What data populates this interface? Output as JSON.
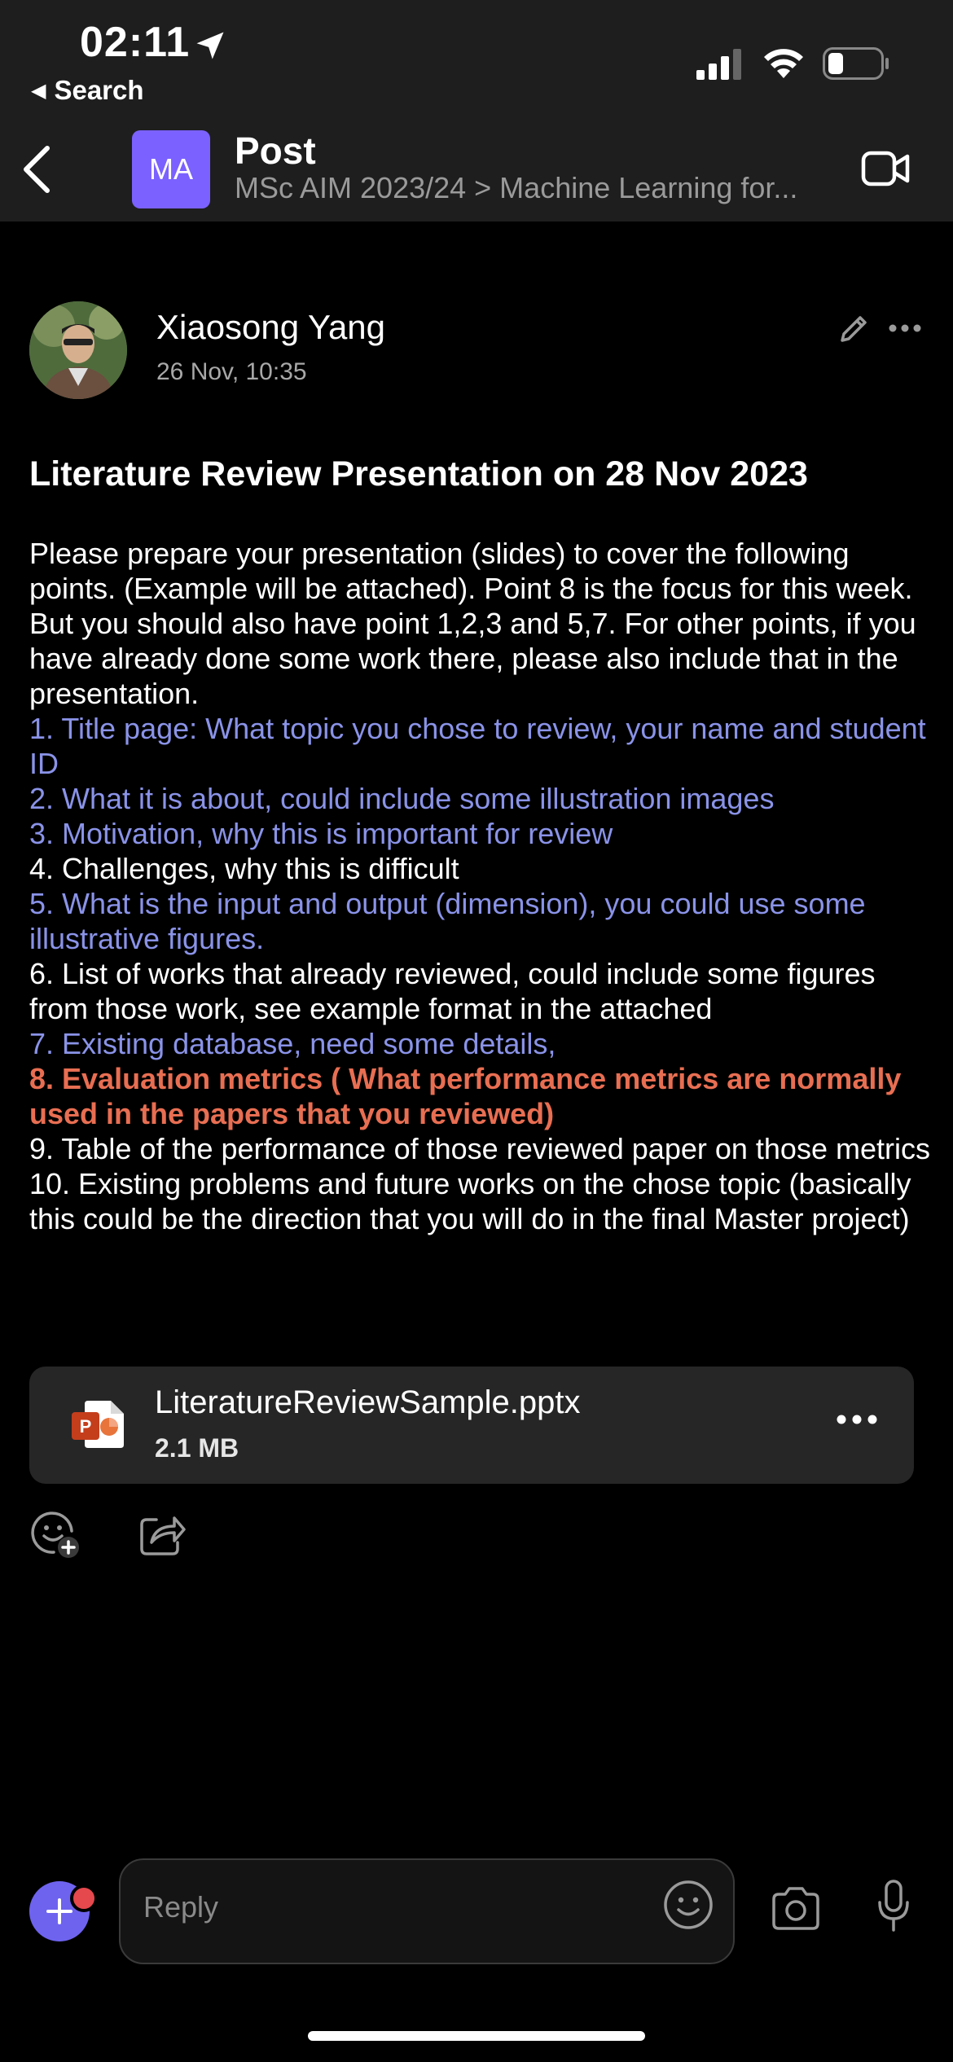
{
  "status_bar": {
    "time": "02:11",
    "back_app": "Search"
  },
  "header": {
    "team_initials": "MA",
    "title": "Post",
    "breadcrumb": "MSc AIM 2023/24 > Machine Learning for..."
  },
  "post": {
    "author": "Xiaosong Yang",
    "timestamp": "26 Nov, 10:35",
    "heading": "Literature Review Presentation on 28 Nov 2023",
    "intro": "Please prepare your presentation (slides) to cover the following points. (Example will be attached). Point 8 is the focus for this week. But you should also have point 1,2,3 and 5,7. For other points, if you have already done some work there, please also include that in the presentation.",
    "points": [
      "1. Title page: What topic you chose to review, your name and student ID",
      "2. What it is about, could include some illustration images",
      "3. Motivation, why this is important for review",
      "4. Challenges, why this is difficult",
      "5. What is the input and output (dimension), you could use some illustrative figures.",
      "6. List of works that already reviewed, could include some figures from those work, see example format in the attached",
      "7. Existing database, need some details,",
      "8. Evaluation metrics ( What performance metrics are normally used in the papers that you reviewed)",
      "9. Table of the performance of those reviewed paper on those metrics",
      "10. Existing problems and future works on the chose topic (basically this could be the direction that you will do in the final Master project)"
    ]
  },
  "attachment": {
    "file_name": "LiteratureReviewSample.pptx",
    "file_size": "2.1 MB"
  },
  "reply": {
    "placeholder": "Reply"
  },
  "colors": {
    "accent": "#7b61ff",
    "highlight_blue": "#8a93e8",
    "highlight_red": "#e86e52",
    "header_bg": "#1e1e1e"
  }
}
